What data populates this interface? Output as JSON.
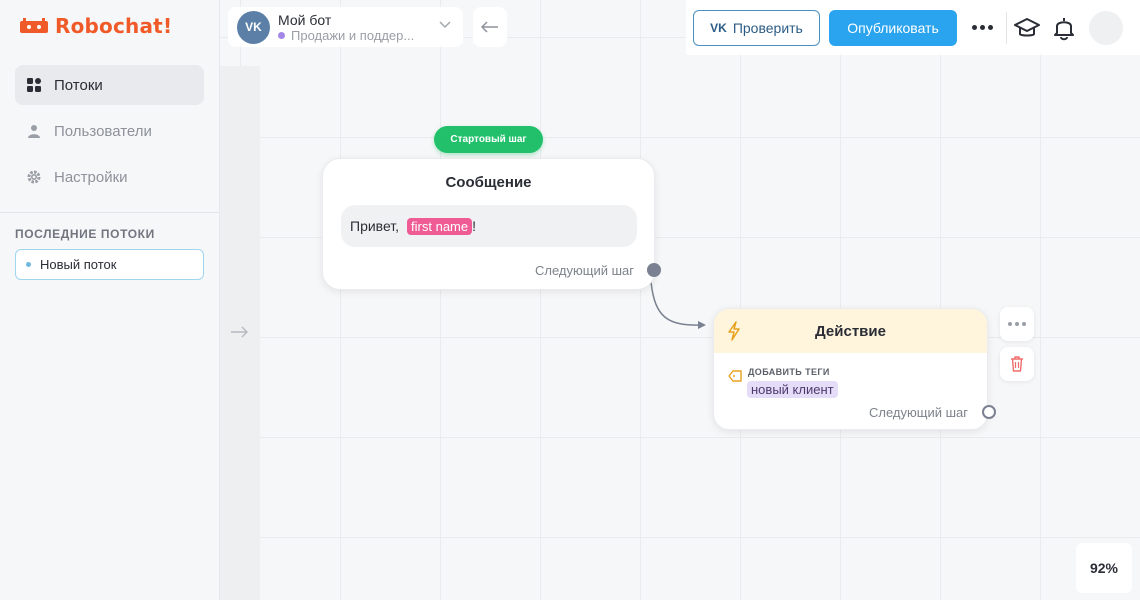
{
  "app": {
    "brand": "Robochat!",
    "brand_color": "#f05a28"
  },
  "sidebar": {
    "items": [
      {
        "label": "Потоки",
        "icon": "grid-icon",
        "active": true
      },
      {
        "label": "Пользователи",
        "icon": "user-icon",
        "active": false
      },
      {
        "label": "Настройки",
        "icon": "gear-icon",
        "active": false
      }
    ],
    "recent_title": "ПОСЛЕДНИЕ ПОТОКИ",
    "recent_items": [
      {
        "label": "Новый поток"
      }
    ]
  },
  "header": {
    "bot_name": "Мой бот",
    "bot_channel": "Продажи и поддер...",
    "vk_badge": "VK",
    "check_label": "Проверить",
    "publish_label": "Опубликовать"
  },
  "flow": {
    "start_badge": "Стартовый шаг",
    "message_node": {
      "title": "Сообщение",
      "text_before": "Привет,",
      "variable": "first name",
      "text_after": "!",
      "next_label": "Следующий шаг"
    },
    "action_node": {
      "title": "Действие",
      "tag_section_label": "ДОБАВИТЬ ТЕГИ",
      "tag": "новый клиент",
      "next_label": "Следующий шаг"
    }
  },
  "zoom": "92%",
  "colors": {
    "accent": "#2aa4ee",
    "start": "#22c06b",
    "variable": "#ef5c95",
    "action_header": "#fff5dd"
  }
}
